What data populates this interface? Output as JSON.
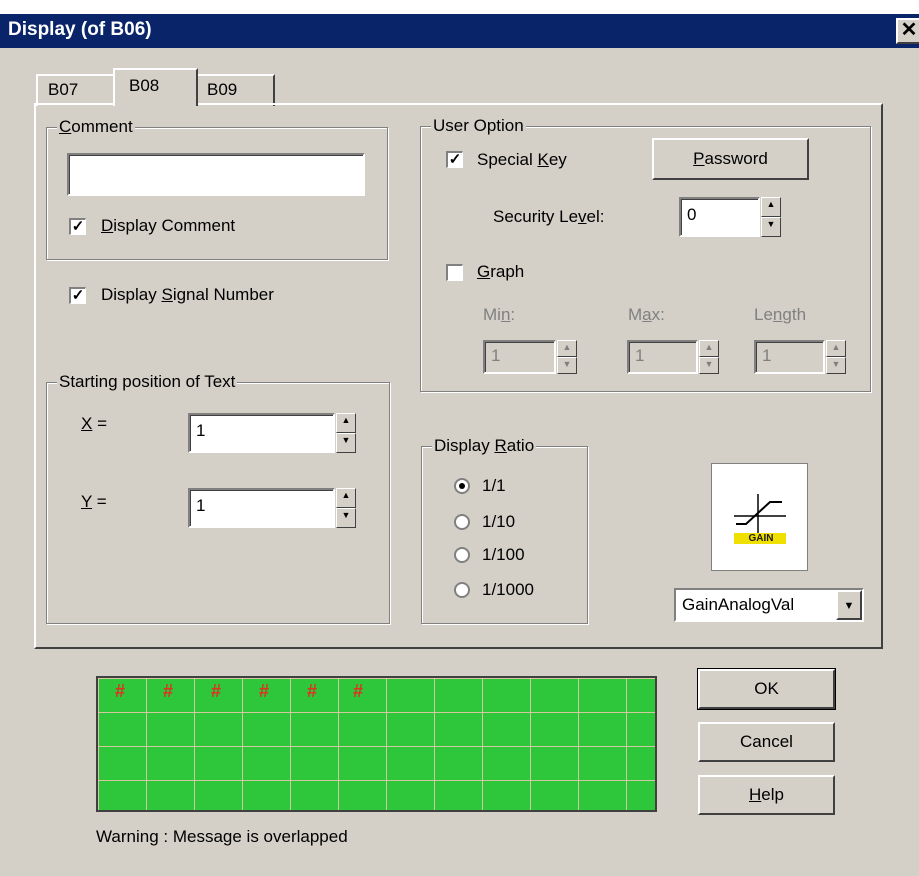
{
  "window": {
    "title": "Display (of B06)",
    "close_glyph": "✕"
  },
  "tabs": [
    {
      "label": "B07"
    },
    {
      "label": "B08"
    },
    {
      "label": "B09"
    }
  ],
  "active_tab": "B08",
  "comment_group": {
    "label_pre": "",
    "label_ul": "C",
    "label_post": "omment",
    "value": "",
    "checkbox": {
      "label_pre": "",
      "label_ul": "D",
      "label_post": "isplay Comment",
      "checked": true
    }
  },
  "signal_number": {
    "label_pre": "Display ",
    "label_ul": "S",
    "label_post": "ignal Number",
    "checked": true
  },
  "position_group": {
    "label": "Starting position of Text",
    "x_label_ul": "X",
    "x_label_post": " =",
    "x_value": "1",
    "y_label_ul": "Y",
    "y_label_post": " =",
    "y_value": "1"
  },
  "user_option": {
    "label": "User Option",
    "special_key": {
      "label_pre": "Special ",
      "label_ul": "K",
      "label_post": "ey",
      "checked": true
    },
    "password_button": {
      "label_ul": "P",
      "label_post": "assword"
    },
    "security_level": {
      "label_pre": "Security Le",
      "label_ul": "v",
      "label_post": "el:",
      "value": "0"
    },
    "graph": {
      "label_ul": "G",
      "label_post": "raph",
      "checked": false
    },
    "min": {
      "label_pre": "Mi",
      "label_ul": "n",
      "label_post": ":",
      "value": "1"
    },
    "max": {
      "label_pre": "M",
      "label_ul": "a",
      "label_post": "x:",
      "value": "1"
    },
    "length": {
      "label_pre": "Le",
      "label_ul": "n",
      "label_post": "gth",
      "value": "1"
    }
  },
  "display_ratio": {
    "label_pre": "Display ",
    "label_ul": "R",
    "label_post": "atio",
    "options": [
      "1/1",
      "1/10",
      "1/100",
      "1/1000"
    ],
    "selected": "1/1"
  },
  "gain_icon": {
    "icon": "gain-icon",
    "caption": "GAIN"
  },
  "type_select": {
    "value": "GainAnalogVal"
  },
  "buttons": {
    "ok": "OK",
    "cancel": "Cancel",
    "help_ul": "H",
    "help_post": "elp"
  },
  "preview": {
    "marker": "#",
    "marker_count": 6,
    "marker_color": "#e03020",
    "background": "#2ec63a"
  },
  "warning": "Warning : Message is overlapped"
}
